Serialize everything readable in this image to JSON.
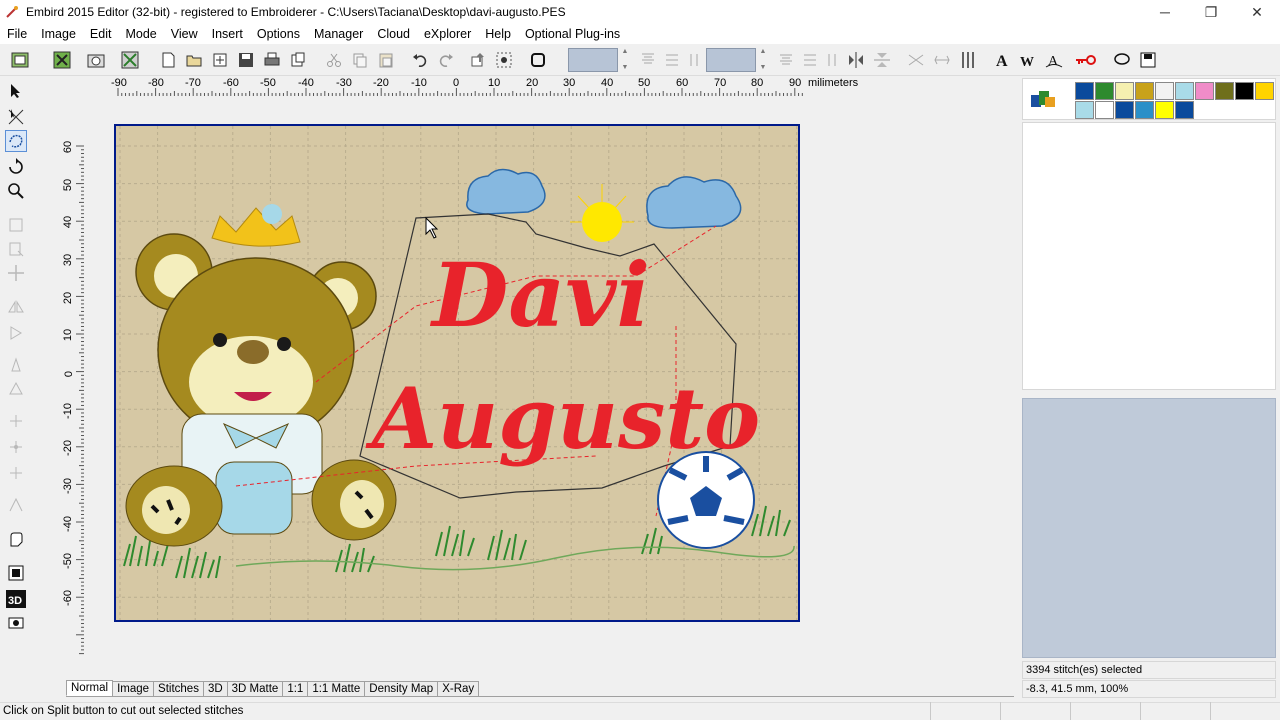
{
  "window": {
    "title": "Embird 2015 Editor (32-bit) - registered to Embroiderer - C:\\Users\\Taciana\\Desktop\\davi-augusto.PES",
    "minimize": "─",
    "restore": "❐",
    "close": "✕"
  },
  "menu": [
    "File",
    "Image",
    "Edit",
    "Mode",
    "View",
    "Insert",
    "Options",
    "Manager",
    "Cloud",
    "eXplorer",
    "Help",
    "Optional Plug-ins"
  ],
  "ruler": {
    "unit": "milimeters",
    "top_ticks": [
      "-90",
      "-80",
      "-70",
      "-60",
      "-50",
      "-40",
      "-30",
      "-20",
      "-10",
      "0",
      "10",
      "20",
      "30",
      "40",
      "50",
      "60",
      "70",
      "80",
      "90"
    ],
    "left_ticks": [
      "60",
      "50",
      "40",
      "30",
      "20",
      "10",
      "0",
      "-10",
      "-20",
      "-30",
      "-40",
      "-50",
      "-60"
    ]
  },
  "design": {
    "text_line1": "Davi",
    "text_line2": "Augusto",
    "text_color": "#e8232b",
    "hoop_border_color": "#001a8a",
    "hoop_fill": "#d6c8a4"
  },
  "palette": {
    "colors": [
      "#0a4a9c",
      "#2e8a2e",
      "#f5f0b0",
      "#c8a21a",
      "#f2f2f2",
      "#a9dbe8",
      "#f08cc8",
      "#6f6f1c",
      "#000000",
      "#ffd400",
      "#a9dbe8",
      "#ffffff",
      "#0a4a9c",
      "#2a8fc8",
      "#ffff00",
      "#0a4a9c"
    ]
  },
  "tabs": [
    "Normal",
    "Image",
    "Stitches",
    "3D",
    "3D Matte",
    "1:1",
    "1:1 Matte",
    "Density Map",
    "X-Ray"
  ],
  "info": {
    "selection": "3394 stitch(es) selected",
    "coordinates": "-8.3, 41.5 mm, 100%"
  },
  "status": {
    "hint": "Click on Split button to cut out selected stitches"
  },
  "toolbar": {
    "field1_value": "",
    "field2_value": ""
  }
}
